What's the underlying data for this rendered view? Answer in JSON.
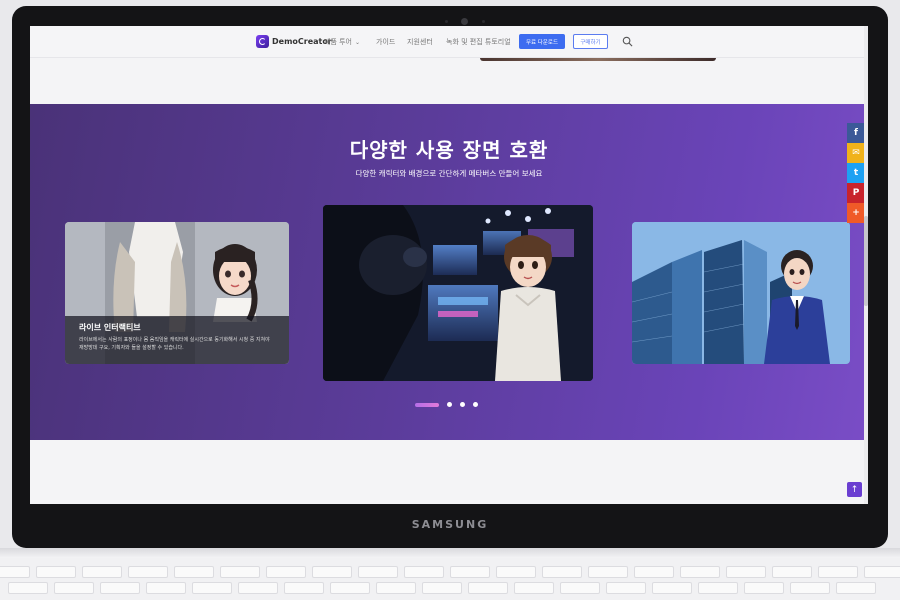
{
  "device": {
    "brand": "SAMSUNG"
  },
  "nav": {
    "logo_text": "DemoCreator",
    "items": [
      "제품 투어",
      "가이드",
      "지원센터",
      "녹화 및 편집 튜토리얼"
    ],
    "download_label": "무료 다운로드",
    "buy_label": "구매하기",
    "search_icon": "search-icon"
  },
  "hero": {
    "title": "다양한 사용 장면 호환",
    "subtitle": "다양한 캐릭터와 배경으로 간단하게 메타버스 만들어 보세요"
  },
  "carousel": {
    "active_slide": 0,
    "slide_count": 4,
    "cards": [
      {
        "caption_title": "라이브 인터랙티브",
        "caption_desc": "라이브에서는 사람의 표정이나 몸 움직임을 캐릭터에 실시간으로 동기화해서 시청 중 지쳐야 재방방데 구요, 기획자와 들을 설정할 수 있습니다."
      },
      {
        "caption_title": "",
        "caption_desc": ""
      },
      {
        "caption_title": "",
        "caption_desc": ""
      }
    ]
  },
  "social": [
    {
      "label": "f",
      "icon": "facebook-icon",
      "color": "#3b5998"
    },
    {
      "label": "✉",
      "icon": "message-icon",
      "color": "#f0b21a"
    },
    {
      "label": "t",
      "icon": "twitter-icon",
      "color": "#1da1f2"
    },
    {
      "label": "P",
      "icon": "pinterest-icon",
      "color": "#c8232c"
    },
    {
      "label": "+",
      "icon": "plus-icon",
      "color": "#f05a28"
    }
  ],
  "back_to_top": "↑",
  "colors": {
    "accent": "#3d6cf0",
    "brand_purple": "#6a3ed1",
    "hero_start": "#4a3278",
    "hero_end": "#7a4dc6"
  }
}
